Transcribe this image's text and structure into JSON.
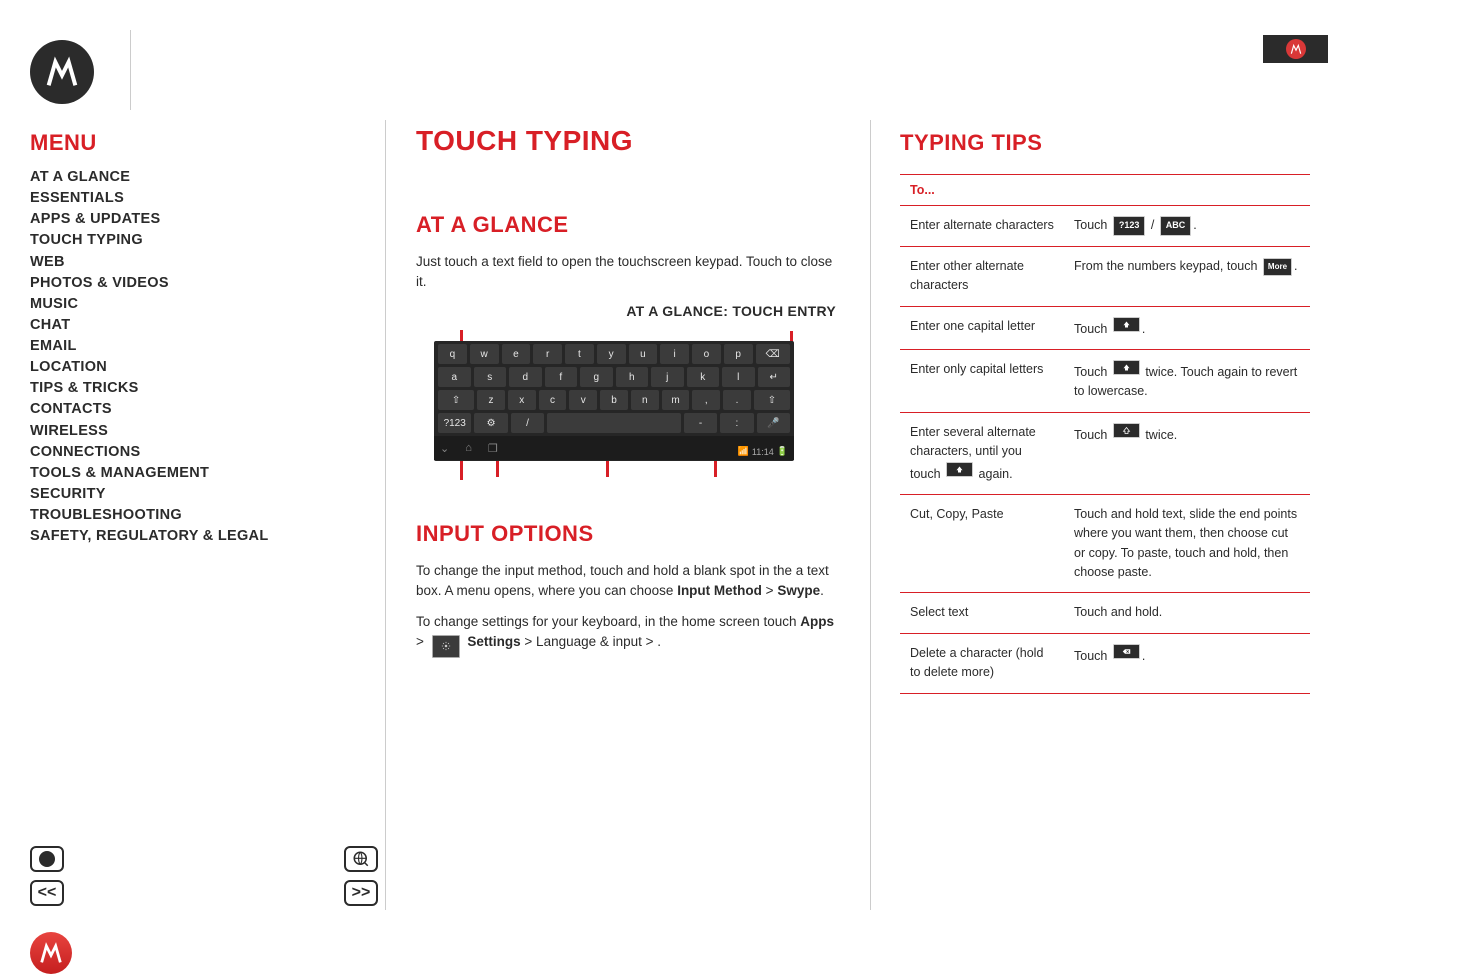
{
  "menu": {
    "title": "MENU",
    "items": [
      "AT A GLANCE",
      "ESSENTIALS",
      "APPS & UPDATES",
      "TOUCH TYPING",
      "WEB",
      "PHOTOS & VIDEOS",
      "MUSIC",
      "CHAT",
      "EMAIL",
      "LOCATION",
      "TIPS & TRICKS",
      "CONTACTS",
      "WIRELESS",
      "CONNECTIONS",
      "TOOLS & MANAGEMENT",
      "SECURITY",
      "TROUBLESHOOTING",
      "SAFETY, REGULATORY & LEGAL"
    ]
  },
  "center": {
    "title": "TOUCH TYPING",
    "section1_title": "AT A GLANCE",
    "section1_body": "Just touch a text field to open the touchscreen keypad. Touch  to close it.",
    "subhead": "AT A GLANCE: TOUCH ENTRY",
    "section2_title": "INPUT OPTIONS",
    "section2_body_pre": "To change the input method, touch and hold a blank spot in the a text box. A menu opens, where you can choose ",
    "section2_body_bold": "Input Method",
    "section2_body_post1": " > ",
    "section2_body_bold2": "Swype",
    "section2_body_post2": ".",
    "section2_body2_pre": "To change settings for your keyboard, in the home screen touch ",
    "section2_body2_label": "Apps",
    "section2_body2_post": " > ",
    "section2_body2_gear": "Settings",
    "section2_body2_tail": " > Language & input > ."
  },
  "keyboard": {
    "row1": [
      "q",
      "w",
      "e",
      "r",
      "t",
      "y",
      "u",
      "i",
      "o",
      "p",
      "⌫"
    ],
    "row2": [
      "a",
      "s",
      "d",
      "f",
      "g",
      "h",
      "j",
      "k",
      "l",
      "↵"
    ],
    "row3": [
      "⇧",
      "z",
      "x",
      "c",
      "v",
      "b",
      "n",
      "m",
      ",",
      ".",
      "⇧"
    ],
    "row4": [
      "?123",
      "⚙",
      "/",
      " ",
      "-",
      ":",
      "🎤"
    ],
    "clock": "11:14"
  },
  "tips": {
    "title": "TYPING TIPS",
    "th1": "To...",
    "rows": [
      {
        "left": "Enter alternate characters",
        "right_pre": "Touch ",
        "k1": "?123",
        "mid": " / ",
        "k2": "ABC",
        "right_post": "."
      },
      {
        "left": "Enter other alternate characters",
        "right_pre": "From the numbers keypad, touch ",
        "k1": "More",
        "right_post": "."
      },
      {
        "left": "Enter one capital letter",
        "right_pre": "Touch ",
        "icon": "up-filled",
        "right_post": "."
      },
      {
        "left": "Enter only capital letters",
        "right_pre": "Touch ",
        "icon": "up-filled",
        "right_post": " twice. Touch again to revert to lowercase."
      },
      {
        "left": "Enter several alternate characters, until you touch",
        "left_icon": "up-filled",
        "left_post": " again.",
        "right_pre": "Touch ",
        "icon": "up-outline",
        "right_post": " twice."
      },
      {
        "left": "Cut, Copy, Paste",
        "right_pre": "Touch and hold text, slide the end points where you want them, then choose cut or copy. To paste, touch and hold, then choose paste."
      },
      {
        "left": "Select text",
        "right_pre": "Touch and hold."
      },
      {
        "left": "Delete a character (hold to delete more)",
        "right_pre": "Touch ",
        "icon": "bksp",
        "right_post": "."
      }
    ]
  },
  "nav": {
    "prev": "<<",
    "next": ">>"
  }
}
